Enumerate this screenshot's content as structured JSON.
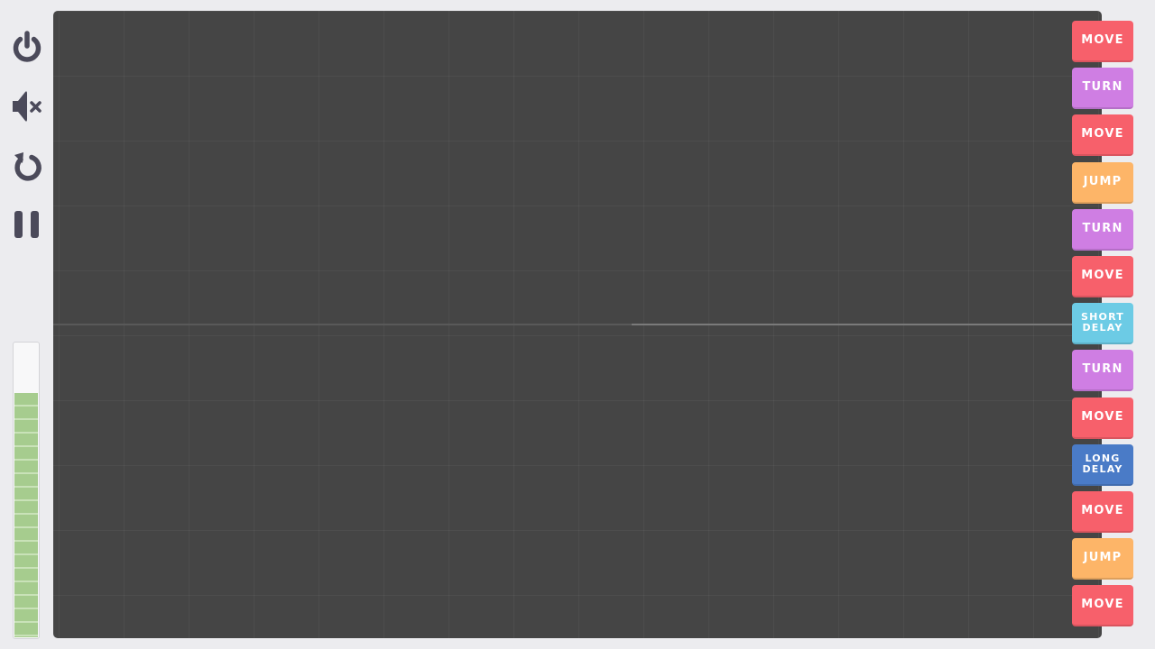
{
  "controls": [
    {
      "name": "power-icon"
    },
    {
      "name": "mute-icon"
    },
    {
      "name": "restart-icon"
    },
    {
      "name": "pause-icon"
    }
  ],
  "meter": {
    "level": 0.83,
    "color": "#a6cc8e"
  },
  "stage": {
    "background": "#454545"
  },
  "commands": [
    {
      "label": "MOVE",
      "color": "#f7606b"
    },
    {
      "label": "TURN",
      "color": "#cf7ee3"
    },
    {
      "label": "MOVE",
      "color": "#f7606b"
    },
    {
      "label": "JUMP",
      "color": "#fdb568"
    },
    {
      "label": "TURN",
      "color": "#cf7ee3"
    },
    {
      "label": "MOVE",
      "color": "#f7606b"
    },
    {
      "label": "SHORT\nDELAY",
      "color": "#6ccbe5"
    },
    {
      "label": "TURN",
      "color": "#cf7ee3"
    },
    {
      "label": "MOVE",
      "color": "#f7606b"
    },
    {
      "label": "LONG\nDELAY",
      "color": "#4a7bc7"
    },
    {
      "label": "MOVE",
      "color": "#f7606b"
    },
    {
      "label": "JUMP",
      "color": "#fdb568"
    },
    {
      "label": "MOVE",
      "color": "#f7606b"
    }
  ]
}
